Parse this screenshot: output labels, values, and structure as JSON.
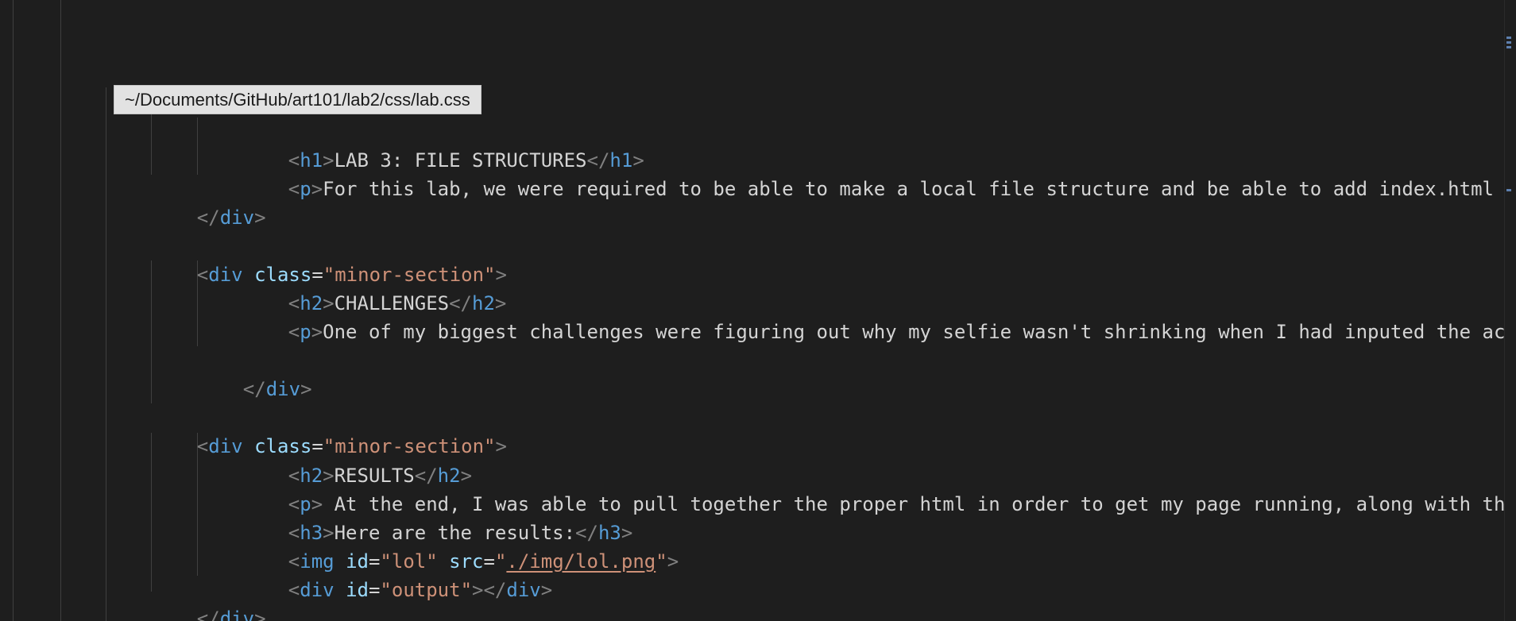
{
  "hover_tooltip": "~/Documents/GitHub/art101/lab2/css/lab.css",
  "code": {
    "h1_line": {
      "open": "h1",
      "text": "LAB 3: FILE STRUCTURES",
      "close": "h1"
    },
    "p_line_1": {
      "open": "p",
      "text": "For this lab, we were required to be able to make a local file structure and be able to add index.html file"
    },
    "div_close_1": {
      "tag": "div"
    },
    "div_open_2": {
      "tag": "div",
      "attr": "class",
      "value": "\"minor-section\""
    },
    "h2_challenges": {
      "open": "h2",
      "text": "CHALLENGES",
      "close": "h2"
    },
    "p_line_2": {
      "open": "p",
      "text": "One of my biggest challenges were figuring out why my selfie wasn't shrinking when I had inputed the accura"
    },
    "div_close_2": {
      "tag": "div"
    },
    "div_open_3": {
      "tag": "div",
      "attr": "class",
      "value": "\"minor-section\""
    },
    "h2_results": {
      "open": "h2",
      "text": "RESULTS",
      "close": "h2"
    },
    "p_line_3": {
      "open": "p",
      "text": " At the end, I was able to pull together the proper html in order to get my page running, along with the ac"
    },
    "h3_line": {
      "open": "h3",
      "text": "Here are the results:",
      "close": "h3"
    },
    "img_line": {
      "tag": "img",
      "attr1": "id",
      "value1": "\"lol\"",
      "attr2": "src",
      "value2_link": "./img/lol.png"
    },
    "output_div": {
      "tag": "div",
      "attr": "id",
      "value": "\"output\"",
      "close": "div"
    },
    "div_close_3": {
      "tag": "div"
    }
  },
  "colors": {
    "background": "#1e1e1e",
    "tag": "#569cd6",
    "attribute": "#9cdcfe",
    "string": "#ce9178",
    "punctuation": "#808080",
    "text": "#d4d4d4"
  }
}
